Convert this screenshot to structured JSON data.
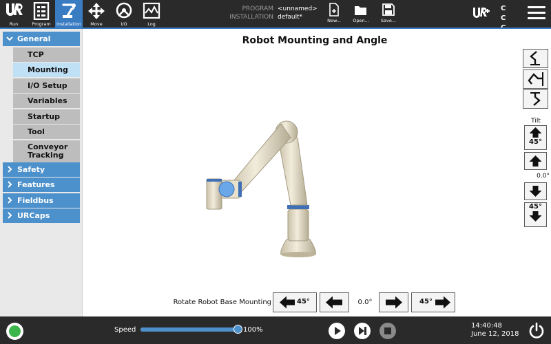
{
  "topbar": {
    "nav": [
      {
        "label": "Run",
        "icon": "ur-logo-icon"
      },
      {
        "label": "Program",
        "icon": "program-icon"
      },
      {
        "label": "Installation",
        "icon": "installation-icon"
      },
      {
        "label": "Move",
        "icon": "move-icon"
      },
      {
        "label": "I/O",
        "icon": "io-icon"
      },
      {
        "label": "Log",
        "icon": "log-icon"
      }
    ],
    "program_key": "PROGRAM",
    "program_value": "<unnamed>",
    "installation_key": "INSTALLATION",
    "installation_value": "default*",
    "file_buttons": [
      {
        "label": "New...",
        "icon": "new-file-icon"
      },
      {
        "label": "Open...",
        "icon": "open-folder-icon"
      },
      {
        "label": "Save...",
        "icon": "save-icon"
      }
    ],
    "cc_row1": "C C",
    "cc_row2": "C C",
    "accent": "#3a7cc2"
  },
  "sidebar": {
    "sections": [
      {
        "label": "General",
        "expanded": true
      },
      {
        "label": "Safety",
        "expanded": false
      },
      {
        "label": "Features",
        "expanded": false
      },
      {
        "label": "Fieldbus",
        "expanded": false
      },
      {
        "label": "URCaps",
        "expanded": false
      }
    ],
    "general_items": [
      {
        "label": "TCP"
      },
      {
        "label": "Mounting",
        "selected": true
      },
      {
        "label": "I/O Setup"
      },
      {
        "label": "Variables"
      },
      {
        "label": "Startup"
      },
      {
        "label": "Tool"
      },
      {
        "label": "Conveyor Tracking"
      }
    ],
    "section_color": "#4d91cc",
    "selected_color": "#bfe0f5"
  },
  "main": {
    "title": "Robot Mounting and Angle",
    "tilt": {
      "label": "Tilt",
      "up_big_deg": "45°",
      "current": "0.0°",
      "down_big_deg": "45°"
    },
    "rotate": {
      "label": "Rotate Robot Base Mounting",
      "left_big_deg": "45°",
      "current": "0.0°",
      "right_big_deg": "45°"
    },
    "view_buttons": [
      "mount-floor-icon",
      "mount-wall-icon",
      "mount-ceiling-icon"
    ]
  },
  "bottombar": {
    "speed_label": "Speed",
    "speed_value": "100%",
    "speed_fraction": 1.0,
    "time": "14:40:48",
    "date": "June 12, 2018",
    "status_color": "#3cb54a"
  }
}
